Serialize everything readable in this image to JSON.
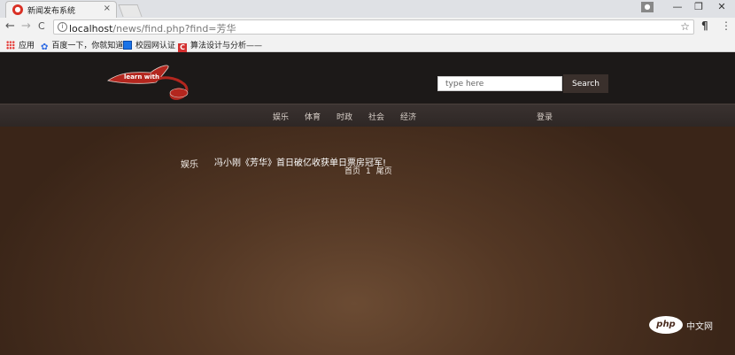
{
  "browser": {
    "tab": {
      "title": "新闻发布系统",
      "close": "×"
    },
    "window_controls": [
      "—",
      "❐",
      "✕"
    ],
    "nav": {
      "back": "←",
      "forward": "→",
      "reload": "C"
    },
    "address": {
      "host": "localhost",
      "path": "/news/find.php?find=芳华"
    },
    "bookmarks": [
      {
        "label": "应用",
        "icon": "apps-grid-icon",
        "color": "#4285f4"
      },
      {
        "label": "百度一下，你就知道",
        "icon": "baidu-paw-icon",
        "color": "#2d6ae4"
      },
      {
        "label": "校园网认证",
        "icon": "campus-net-icon",
        "color": "#1a73e8"
      },
      {
        "label": "算法设计与分析——",
        "icon": "csdn-c-icon",
        "color": "#d32f2f"
      }
    ]
  },
  "site": {
    "logo_text": "learn with",
    "search": {
      "placeholder": "type here",
      "button": "Search"
    },
    "menu": [
      "娱乐",
      "体育",
      "时政",
      "社会",
      "经济"
    ],
    "login": "登录",
    "results": [
      {
        "category": "娱乐",
        "title": "冯小刚《芳华》首日破亿收获单日票房冠军!"
      }
    ],
    "pager": {
      "first": "首页",
      "current": "1",
      "last": "尾页"
    },
    "watermark": {
      "logo": "php",
      "text": "中文网"
    },
    "colors": {
      "header": "#1c1918",
      "menubar": "#332b28",
      "content": "#5a3c28"
    }
  }
}
